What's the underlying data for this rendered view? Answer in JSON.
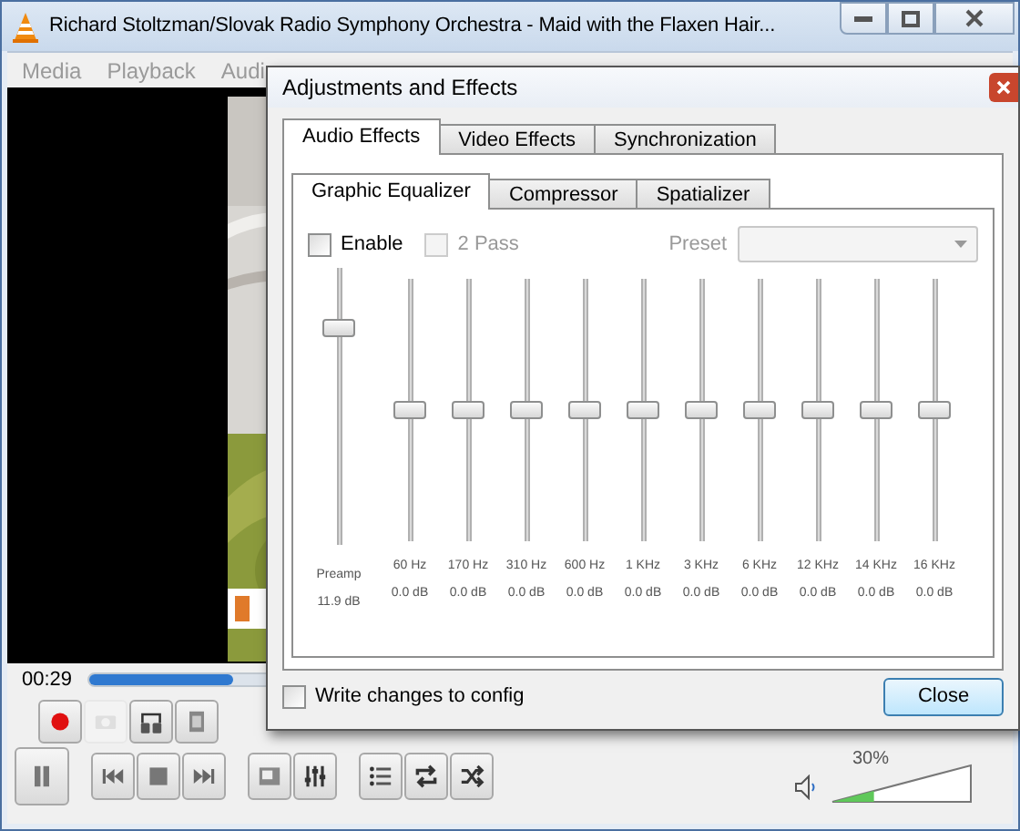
{
  "window": {
    "title": "Richard Stoltzman/Slovak Radio Symphony Orchestra - Maid with the Flaxen Hair..."
  },
  "menu": [
    "Media",
    "Playback",
    "Audi"
  ],
  "dialog": {
    "title": "Adjustments and Effects",
    "tabs": [
      {
        "label": "Audio Effects",
        "selected": true
      },
      {
        "label": "Video Effects",
        "selected": false
      },
      {
        "label": "Synchronization",
        "selected": false
      }
    ],
    "subtabs": [
      {
        "label": "Graphic Equalizer",
        "selected": true
      },
      {
        "label": "Compressor",
        "selected": false
      },
      {
        "label": "Spatializer",
        "selected": false
      }
    ],
    "enable": {
      "label": "Enable",
      "checked": false
    },
    "two_pass": {
      "label": "2 Pass",
      "checked": false,
      "disabled": true
    },
    "preset": {
      "label": "Preset",
      "disabled": true
    },
    "preamp": {
      "label": "Preamp",
      "reading": "11.9 dB",
      "level": 0.8
    },
    "bands": [
      {
        "label": "60 Hz",
        "reading": "0.0 dB",
        "level": 0.5
      },
      {
        "label": "170 Hz",
        "reading": "0.0 dB",
        "level": 0.5
      },
      {
        "label": "310 Hz",
        "reading": "0.0 dB",
        "level": 0.5
      },
      {
        "label": "600 Hz",
        "reading": "0.0 dB",
        "level": 0.5
      },
      {
        "label": "1 KHz",
        "reading": "0.0 dB",
        "level": 0.5
      },
      {
        "label": "3 KHz",
        "reading": "0.0 dB",
        "level": 0.5
      },
      {
        "label": "6 KHz",
        "reading": "0.0 dB",
        "level": 0.5
      },
      {
        "label": "12 KHz",
        "reading": "0.0 dB",
        "level": 0.5
      },
      {
        "label": "14 KHz",
        "reading": "0.0 dB",
        "level": 0.5
      },
      {
        "label": "16 KHz",
        "reading": "0.0 dB",
        "level": 0.5
      }
    ],
    "write_config": {
      "label": "Write changes to config",
      "checked": false
    },
    "close_button": "Close"
  },
  "player": {
    "time": "00:29",
    "progress": {
      "level": 0.17
    },
    "buttons_top": [
      {
        "kind": "record",
        "disabled": false
      },
      {
        "kind": "snapshot",
        "disabled": true
      },
      {
        "kind": "loop-ab",
        "disabled": false
      },
      {
        "kind": "frame",
        "disabled": false
      }
    ],
    "buttons_bottom": [
      [
        {
          "kind": "pause"
        }
      ],
      [
        {
          "kind": "previous"
        },
        {
          "kind": "stop"
        },
        {
          "kind": "next"
        }
      ],
      [
        {
          "kind": "fullscreen"
        },
        {
          "kind": "equalizer"
        }
      ],
      [
        {
          "kind": "playlist"
        },
        {
          "kind": "repeat"
        },
        {
          "kind": "shuffle"
        }
      ]
    ],
    "volume": {
      "reading": "30%",
      "level": 0.3
    }
  }
}
